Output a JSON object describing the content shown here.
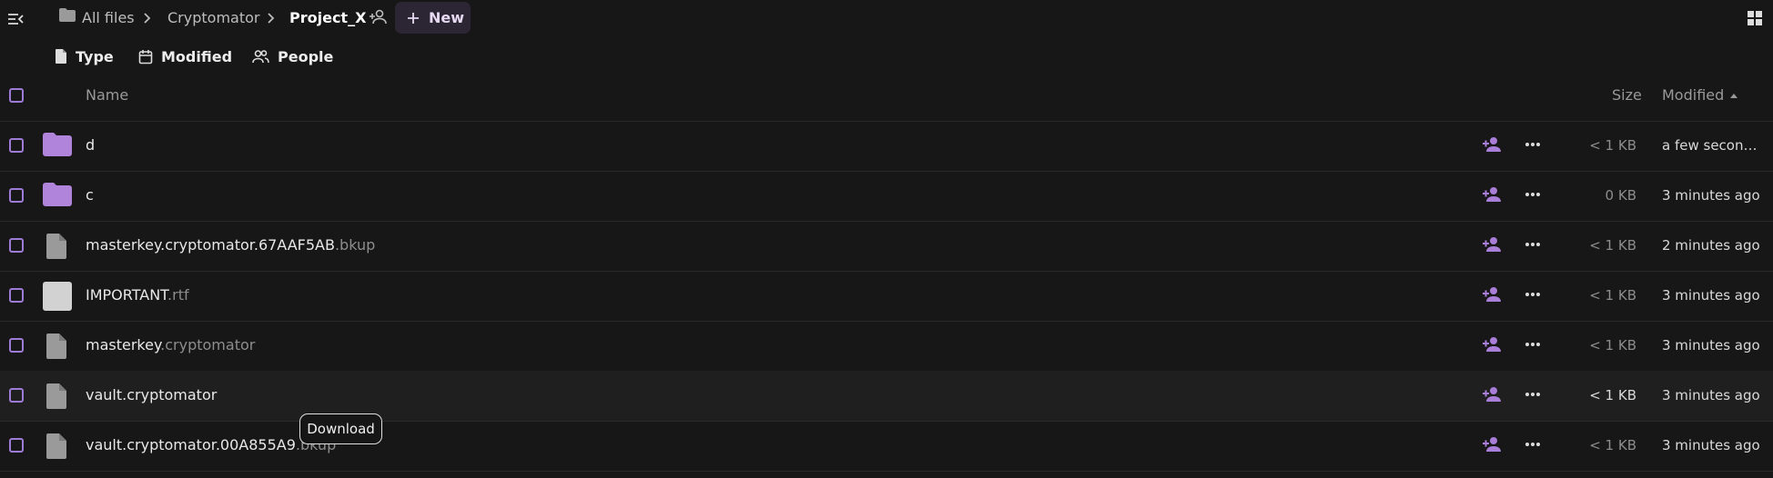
{
  "breadcrumb": {
    "all_files": "All files",
    "parent": "Cryptomator",
    "current": "Project_X"
  },
  "new_button": "New",
  "filters": {
    "type": "Type",
    "modified": "Modified",
    "people": "People"
  },
  "table": {
    "col_name": "Name",
    "col_size": "Size",
    "col_modified": "Modified",
    "rows": [
      {
        "name": "d",
        "ext": "",
        "kind": "folder",
        "size": "< 1 KB",
        "modified": "a few seconds ago"
      },
      {
        "name": "c",
        "ext": "",
        "kind": "folder",
        "size": "0 KB",
        "modified": "3 minutes ago"
      },
      {
        "name": "masterkey.cryptomator.67AAF5AB",
        "ext": ".bkup",
        "kind": "file",
        "size": "< 1 KB",
        "modified": "2 minutes ago"
      },
      {
        "name": "IMPORTANT",
        "ext": ".rtf",
        "kind": "document",
        "size": "< 1 KB",
        "modified": "3 minutes ago"
      },
      {
        "name": "masterkey",
        "ext": ".cryptomator",
        "kind": "file",
        "size": "< 1 KB",
        "modified": "3 minutes ago"
      },
      {
        "name": "vault.cryptomator",
        "ext": "",
        "kind": "file",
        "size": "< 1 KB",
        "modified": "3 minutes ago"
      },
      {
        "name": "vault.cryptomator.00A855A9",
        "ext": ".bkup",
        "kind": "file",
        "size": "< 1 KB",
        "modified": "3 minutes ago"
      }
    ]
  },
  "tooltip": "Download",
  "colors": {
    "accent": "#a97ed8",
    "background": "#171717",
    "folder": "#b184db"
  }
}
